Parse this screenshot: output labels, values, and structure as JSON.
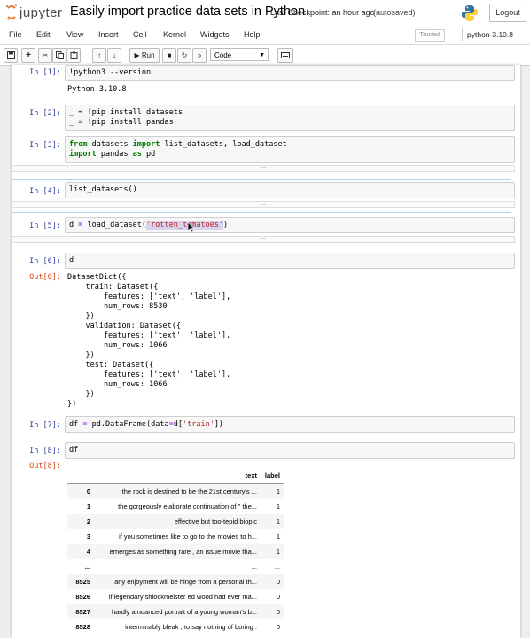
{
  "header": {
    "logo_text": "jupyter",
    "notebook_title": "Easily import practice data sets in Python",
    "checkpoint": "Last Checkpoint: an hour ago",
    "autosaved": "(autosaved)",
    "logout_label": "Logout"
  },
  "menubar": {
    "items": [
      "File",
      "Edit",
      "View",
      "Insert",
      "Cell",
      "Kernel",
      "Widgets",
      "Help"
    ],
    "trusted": "Trusted",
    "kernel": "python-3.10.8"
  },
  "toolbar": {
    "run_label": "Run",
    "cell_type": "Code"
  },
  "cells": {
    "c1": {
      "prompt": "In [1]:",
      "code": "!python3 --version",
      "output": "Python 3.10.8"
    },
    "c2": {
      "prompt": "In [2]:",
      "line1": "_ = !pip install datasets",
      "line2": "_ = !pip install pandas"
    },
    "c3": {
      "prompt": "In [3]:",
      "from_kw": "from",
      "mod1": " datasets ",
      "import_kw": "import",
      "names": " list_datasets, load_dataset",
      "import_kw2": "import",
      "mod2": " pandas ",
      "as_kw": "as",
      "alias": " pd"
    },
    "c4": {
      "prompt": "In [4]:",
      "code": "list_datasets()"
    },
    "c5": {
      "prompt": "In [5]:",
      "pre": "d ",
      "eq": "=",
      "mid": " load_dataset(",
      "arg": "'rotten_tomatoes'",
      "post": ")"
    },
    "c6": {
      "prompt": "In [6]:",
      "code": "d",
      "out_prompt": "Out[6]:",
      "output": "DatasetDict({\n    train: Dataset({\n        features: ['text', 'label'],\n        num_rows: 8530\n    })\n    validation: Dataset({\n        features: ['text', 'label'],\n        num_rows: 1066\n    })\n    test: Dataset({\n        features: ['text', 'label'],\n        num_rows: 1066\n    })\n})"
    },
    "c7": {
      "prompt": "In [7]:",
      "pre": "df ",
      "eq": "=",
      "mid": " pd.DataFrame(data",
      "eq2": "=",
      "mid2": "d[",
      "arg": "'train'",
      "post": "])"
    },
    "c8": {
      "prompt": "In [8]:",
      "code": "df",
      "out_prompt": "Out[8]:"
    }
  },
  "collapsed_label": "...",
  "dataframe": {
    "columns": [
      "",
      "text",
      "label"
    ],
    "rows": [
      [
        "0",
        "the rock is destined to be the 21st century's ...",
        "1"
      ],
      [
        "1",
        "the gorgeously elaborate continuation of \" the...",
        "1"
      ],
      [
        "2",
        "effective but too-tepid biopic",
        "1"
      ],
      [
        "3",
        "if you sometimes like to go to the movies to h...",
        "1"
      ],
      [
        "4",
        "emerges as something rare , an issue movie tha...",
        "1"
      ],
      [
        "...",
        "...",
        "..."
      ],
      [
        "8525",
        "any enjoyment will be hinge from a personal th...",
        "0"
      ],
      [
        "8526",
        "if legendary shlockmeister ed wood had ever ma...",
        "0"
      ],
      [
        "8527",
        "hardly a nuanced portrait of a young woman's b...",
        "0"
      ],
      [
        "8528",
        "interminably bleak , to say nothing of boring .",
        "0"
      ]
    ]
  }
}
